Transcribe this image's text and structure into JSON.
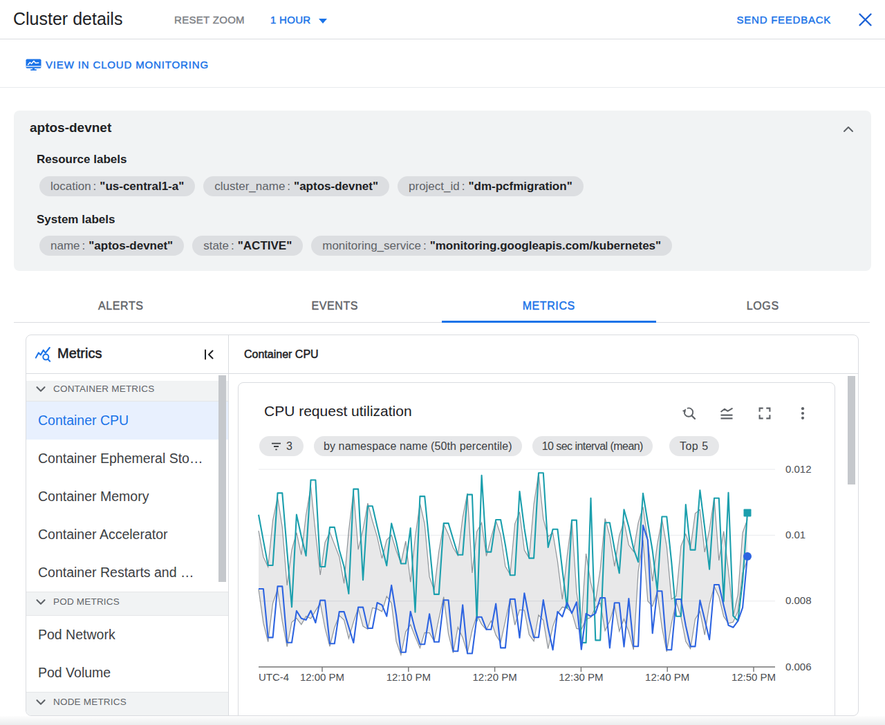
{
  "header": {
    "title": "Cluster details",
    "reset_zoom": "RESET ZOOM",
    "time_range": "1 HOUR",
    "send_feedback": "SEND FEEDBACK"
  },
  "toolbar": {
    "view_link": "VIEW IN CLOUD MONITORING"
  },
  "summary": {
    "name": "aptos-devnet",
    "resource_labels_title": "Resource labels",
    "resource_labels": [
      {
        "key": "location",
        "value": "\"us-central1-a\""
      },
      {
        "key": "cluster_name",
        "value": "\"aptos-devnet\""
      },
      {
        "key": "project_id",
        "value": "\"dm-pcfmigration\""
      }
    ],
    "system_labels_title": "System labels",
    "system_labels": [
      {
        "key": "name",
        "value": "\"aptos-devnet\""
      },
      {
        "key": "state",
        "value": "\"ACTIVE\""
      },
      {
        "key": "monitoring_service",
        "value": "\"monitoring.googleapis.com/kubernetes\""
      }
    ]
  },
  "tabs": {
    "items": [
      "ALERTS",
      "EVENTS",
      "METRICS",
      "LOGS"
    ],
    "active": "METRICS"
  },
  "sidebar": {
    "title": "Metrics",
    "sections": [
      {
        "label": "CONTAINER METRICS",
        "items": [
          "Container CPU",
          "Container Ephemeral Sto…",
          "Container Memory",
          "Container Accelerator",
          "Container Restarts and …"
        ],
        "selected": "Container CPU"
      },
      {
        "label": "POD METRICS",
        "items": [
          "Pod Network",
          "Pod Volume"
        ],
        "selected": null
      },
      {
        "label": "NODE METRICS",
        "items": [],
        "selected": null
      }
    ]
  },
  "main": {
    "title": "Container CPU"
  },
  "card": {
    "title": "CPU request utilization",
    "filter_count": "3",
    "chips": [
      "by namespace name (50th percentile)",
      "10 sec interval (mean)",
      "Top 5"
    ]
  },
  "colors": {
    "accent_blue": "#1a73e8",
    "teal_series": "#1b9fad",
    "blue_series": "#2d64e1",
    "gray_band_edge": "#8f9499",
    "gray_band_fill": "rgba(32,33,36,0.10)"
  },
  "chart_data": {
    "type": "line",
    "title": "CPU request utilization",
    "x_axis_prefix": "UTC-4",
    "x_tick_labels": [
      "12:00 PM",
      "12:10 PM",
      "12:20 PM",
      "12:30 PM",
      "12:40 PM",
      "12:50 PM"
    ],
    "y_tick_labels": [
      "0.012",
      "0.01",
      "0.008",
      "0.006"
    ],
    "y_ticks": [
      0.012,
      0.01,
      0.008,
      0.006
    ],
    "ylim": [
      0.006,
      0.012
    ],
    "grid": true,
    "legend_position": "none",
    "series": [
      {
        "name": "band-upper (gray)",
        "values": [
          0.010136,
          0.009343,
          0.009039,
          0.010452,
          0.011151,
          0.010238,
          0.008476,
          0.009557,
          0.01008,
          0.009406,
          0.010617,
          0.01147,
          0.01006,
          0.008791,
          0.009781,
          0.010088,
          0.009716,
          0.009347,
          0.008535,
          0.010136,
          0.011332,
          0.009566,
          0.010168,
          0.010971,
          0.010432,
          0.009947,
          0.009296,
          0.009853,
          0.010005,
          0.009532,
          0.009157,
          0.009819,
          0.008574,
          0.009934,
          0.010969,
          0.010339,
          0.008734,
          0.008331,
          0.00951,
          0.010338,
          0.010022,
          0.00962,
          0.009384,
          0.010537,
          0.011271,
          0.008857,
          0.010106,
          0.010376,
          0.009364,
          0.00993,
          0.01044,
          0.010011,
          0.009053,
          0.008809,
          0.010346,
          0.010705,
          0.009544,
          0.009307,
          0.010935,
          0.01188,
          0.0105,
          0.009962,
          0.01007,
          0.009206,
          0.008055,
          0.009358,
          0.01047,
          0.008275,
          0.00732,
          0.009441,
          0.008559,
          0.007988,
          0.008962,
          0.010508,
          0.00998,
          0.009056,
          0.009988,
          0.010416,
          0.009705,
          0.009506,
          0.010373,
          0.010863,
          0.009838,
          0.008605,
          0.009709,
          0.01049,
          0.00966,
          0.008057,
          0.008151,
          0.009671,
          0.010033,
          0.009618,
          0.010662,
          0.010779,
          0.009486,
          0.010167,
          0.011141,
          0.009232,
          0.01012,
          0.008927,
          0.007542,
          0.008193,
          0.010078,
          0.01048
        ]
      },
      {
        "name": "band-lower (gray)",
        "values": [
          0.008358,
          0.007334,
          0.006763,
          0.007937,
          0.008351,
          0.00738,
          0.006615,
          0.00736,
          0.007481,
          0.007289,
          0.007541,
          0.007468,
          0.007708,
          0.007935,
          0.007177,
          0.006624,
          0.007196,
          0.007564,
          0.007427,
          0.006865,
          0.007369,
          0.007781,
          0.007238,
          0.007145,
          0.007797,
          0.00776,
          0.007681,
          0.008143,
          0.007937,
          0.006775,
          0.006366,
          0.007068,
          0.007283,
          0.00692,
          0.006577,
          0.007041,
          0.007034,
          0.006781,
          0.007474,
          0.008127,
          0.007001,
          0.006428,
          0.007207,
          0.006888,
          0.006428,
          0.007115,
          0.00757,
          0.007294,
          0.007129,
          0.0074,
          0.006968,
          0.006742,
          0.0074,
          0.008063,
          0.007273,
          0.007733,
          0.00772,
          0.006983,
          0.006781,
          0.007579,
          0.007414,
          0.006552,
          0.00723,
          0.00762,
          0.00782,
          0.007783,
          0.007661,
          0.007166,
          0.00714,
          0.00744,
          0.007504,
          0.007808,
          0.007943,
          0.007102,
          0.007389,
          0.007878,
          0.007083,
          0.007455,
          0.007064,
          0.006525,
          0.008894,
          0.00985,
          0.008,
          0.007843,
          0.008271,
          0.007198,
          0.006466,
          0.007323,
          0.007971,
          0.007517,
          0.006777,
          0.006555,
          0.007454,
          0.007685,
          0.006972,
          0.007909,
          0.008444,
          0.008134,
          0.007534,
          0.00732,
          0.007362,
          0.007687,
          0.008861,
          0.00926
        ]
      },
      {
        "name": "namespace p50 (teal)",
        "marker": "square",
        "values": [
          0.010621,
          0.009838,
          0.009084,
          0.009084,
          0.01128,
          0.01128,
          0.00952,
          0.007819,
          0.010626,
          0.009962,
          0.009372,
          0.011677,
          0.011677,
          0.009043,
          0.009043,
          0.010241,
          0.010241,
          0.009552,
          0.00905,
          0.008225,
          0.011401,
          0.011401,
          0.008639,
          0.010886,
          0.010886,
          0.010257,
          0.009635,
          0.009076,
          0.010359,
          0.009799,
          0.009137,
          0.009137,
          0.010216,
          0.007662,
          0.011181,
          0.011181,
          0.009719,
          0.008205,
          0.008205,
          0.010363,
          0.010363,
          0.009882,
          0.009403,
          0.009403,
          0.011235,
          0.011235,
          0.007404,
          0.011816,
          0.009493,
          0.009493,
          0.010471,
          0.010471,
          0.009703,
          0.008788,
          0.008788,
          0.01133,
          0.010209,
          0.009303,
          0.009303,
          0.011893,
          0.011893,
          0.009631,
          0.010183,
          0.010183,
          0.008951,
          0.007788,
          0.010457,
          0.010457,
          0.006736,
          0.006736,
          0.011125,
          0.00681,
          0.00681,
          0.010382,
          0.010382,
          0.009578,
          0.008848,
          0.010777,
          0.010255,
          0.009591,
          0.009187,
          0.01127,
          0.010387,
          0.009536,
          0.008319,
          0.010565,
          0.010565,
          0.009192,
          0.007539,
          0.007539,
          0.010931,
          0.009555,
          0.009555,
          0.011364,
          0.01023,
          0.008968,
          0.011124,
          0.011124,
          0.007985,
          0.011294,
          0.00755,
          0.0074,
          0.0086,
          0.01068
        ]
      },
      {
        "name": "namespace p50 (blue)",
        "marker": "circle",
        "values": [
          0.008371,
          0.008371,
          0.006893,
          0.006893,
          0.008447,
          0.008447,
          0.006738,
          0.006738,
          0.007705,
          0.007475,
          0.007427,
          0.00771,
          0.007344,
          0.008023,
          0.008023,
          0.006707,
          0.006707,
          0.007677,
          0.007677,
          0.007211,
          0.006734,
          0.007814,
          0.007814,
          0.007175,
          0.007175,
          0.007952,
          0.007881,
          0.007539,
          0.008478,
          0.007573,
          0.006448,
          0.006448,
          0.007685,
          0.00713,
          0.006689,
          0.006689,
          0.00761,
          0.006759,
          0.006759,
          0.00803,
          0.00803,
          0.006479,
          0.006479,
          0.00788,
          0.006409,
          0.006409,
          0.007516,
          0.007516,
          0.007137,
          0.007137,
          0.007921,
          0.00658,
          0.00658,
          0.008059,
          0.008059,
          0.006886,
          0.008241,
          0.007477,
          0.006898,
          0.006898,
          0.008033,
          0.007184,
          0.006519,
          0.007677,
          0.007526,
          0.007954,
          0.007629,
          0.007968,
          0.00653,
          0.007618,
          0.007537,
          0.007628,
          0.008098,
          0.008098,
          0.006579,
          0.007947,
          0.007947,
          0.006617,
          0.008077,
          0.006625,
          0.006625,
          0.0103,
          0.00985,
          0.007022,
          0.008304,
          0.008304,
          0.006519,
          0.006519,
          0.008057,
          0.008057,
          0.007255,
          0.006622,
          0.006622,
          0.008025,
          0.007442,
          0.00683,
          0.008497,
          0.008497,
          0.007862,
          0.007263,
          0.0072,
          0.0074,
          0.0078,
          0.00936
        ]
      }
    ]
  }
}
